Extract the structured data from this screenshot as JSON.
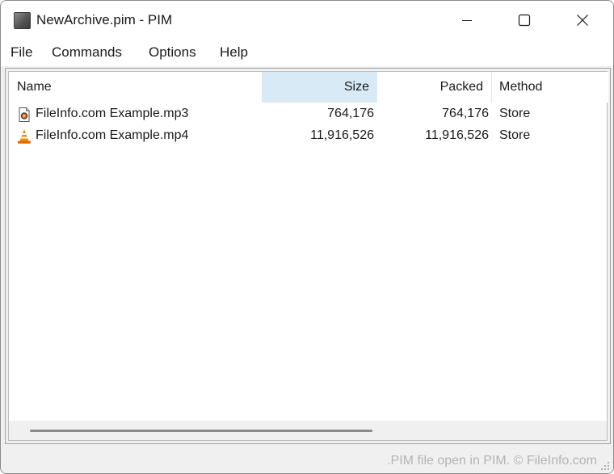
{
  "window": {
    "title": "NewArchive.pim - PIM",
    "app_icon": "pim-archive-icon"
  },
  "menu": {
    "items": [
      "File",
      "Commands",
      "Options",
      "Help"
    ]
  },
  "list": {
    "columns": {
      "name": "Name",
      "size": "Size",
      "packed": "Packed",
      "method": "Method"
    },
    "sorted_column": "Size",
    "rows": [
      {
        "icon": "mp3-audio-file-icon",
        "name": "FileInfo.com Example.mp3",
        "size": "764,176",
        "packed": "764,176",
        "method": "Store"
      },
      {
        "icon": "vlc-cone-icon",
        "name": "FileInfo.com Example.mp4",
        "size": "11,916,526",
        "packed": "11,916,526",
        "method": "Store"
      }
    ]
  },
  "status": {
    "text": ".PIM file open in PIM. © FileInfo.com"
  },
  "colors": {
    "sorted_header_bg": "#d9eaf7",
    "vlc_orange": "#f08c00",
    "status_text": "#b4b4b4"
  }
}
